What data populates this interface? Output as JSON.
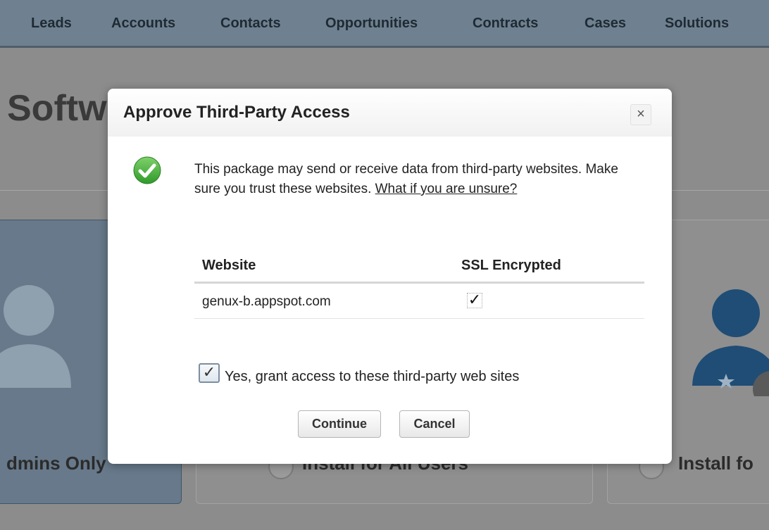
{
  "nav": {
    "items": [
      {
        "label": "Leads"
      },
      {
        "label": "Accounts"
      },
      {
        "label": "Contacts"
      },
      {
        "label": "Opportunities"
      },
      {
        "label": "Contracts"
      },
      {
        "label": "Cases"
      },
      {
        "label": "Solutions"
      }
    ]
  },
  "background": {
    "page_title": "Softw",
    "cards": [
      {
        "label": "dmins Only",
        "selected": true
      },
      {
        "label": "Install for All Users",
        "selected": false
      },
      {
        "label": "Install fo",
        "selected": false
      }
    ]
  },
  "modal": {
    "title": "Approve Third-Party Access",
    "close_glyph": "×",
    "icon": "success-check-icon",
    "message": "This package may send or receive data from third-party websites. Make sure you trust these websites.",
    "help_link": "What if you are unsure?",
    "table": {
      "headers": [
        "Website",
        "SSL Encrypted"
      ],
      "rows": [
        {
          "website": "genux-b.appspot.com",
          "ssl_mark": "✓"
        }
      ]
    },
    "grant": {
      "checked": true,
      "mark": "✓",
      "label": "Yes, grant access to these third-party web sites"
    },
    "buttons": {
      "continue": "Continue",
      "cancel": "Cancel"
    }
  },
  "colors": {
    "overlay": "#8c8c8c",
    "nav_bg": "#6f8190",
    "selected_card": "#67798a",
    "success_green": "#3fa535"
  }
}
